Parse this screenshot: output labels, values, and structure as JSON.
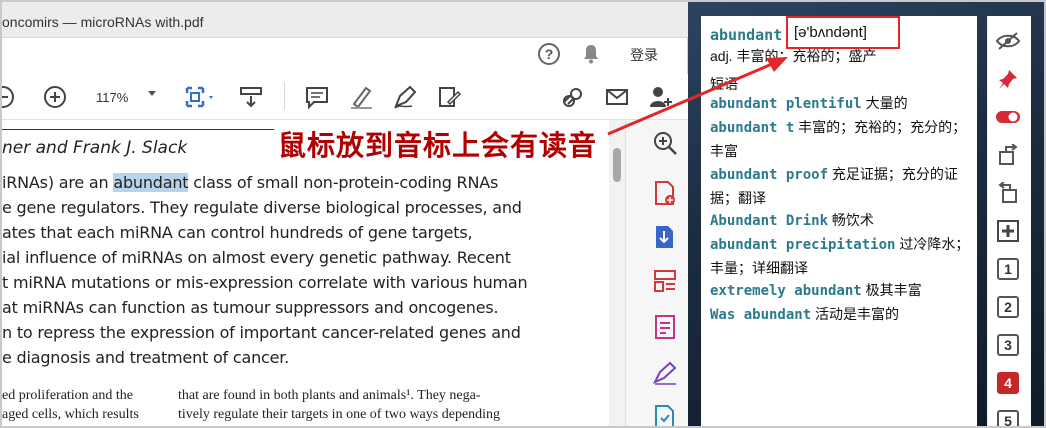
{
  "window": {
    "title": "oncomirs — microRNAs with.pdf"
  },
  "header": {
    "help_glyph": "?",
    "login_label": "登录"
  },
  "toolbar": {
    "zoom_value": "117%"
  },
  "document": {
    "authors": "ner and Frank J. Slack",
    "lines": [
      {
        "pre": "iRNAs) are an ",
        "hl": "abundant",
        "post": " class of small non-protein-coding RNAs"
      },
      {
        "pre": "e gene regulators. They regulate diverse biological processes, and",
        "hl": "",
        "post": ""
      },
      {
        "pre": "ates that each miRNA can control hundreds of gene targets,",
        "hl": "",
        "post": ""
      },
      {
        "pre": "ial influence of miRNAs on almost every genetic pathway. Recent",
        "hl": "",
        "post": ""
      },
      {
        "pre": "t miRNA mutations or mis-expression correlate with various human",
        "hl": "",
        "post": ""
      },
      {
        "pre": "at miRNAs can function as tumour suppressors and oncogenes.",
        "hl": "",
        "post": ""
      },
      {
        "pre": "n to repress the expression of important cancer-related genes and",
        "hl": "",
        "post": ""
      },
      {
        "pre": "e diagnosis and treatment of cancer.",
        "hl": "",
        "post": ""
      }
    ],
    "col_left": [
      "ed proliferation and the",
      "aged cells, which results"
    ],
    "col_right": [
      "that are found in both plants and animals¹. They nega-",
      "tively regulate their targets in one of two ways depending"
    ]
  },
  "annotation": {
    "text": "鼠标放到音标上会有读音",
    "color": "#b00000"
  },
  "dictionary": {
    "headword": "abundant",
    "phonetic": "[ə'bʌndənt]",
    "pos_line": "adj. 丰富的；充裕的；盛产",
    "partial_line": "短语",
    "entries": [
      {
        "key": "abundant plentiful",
        "def": " 大量的"
      },
      {
        "key": "abundant t",
        "def": " 丰富的；充裕的；充分的；丰富"
      },
      {
        "key": "abundant proof",
        "def": " 充足证据；充分的证据；翻译"
      },
      {
        "key": "Abundant Drink",
        "def": " 畅饮术"
      },
      {
        "key": "abundant precipitation",
        "def": " 过冷降水；丰量；详细翻译"
      },
      {
        "key": "extremely abundant",
        "def": " 极其丰富"
      },
      {
        "key": "Was abundant",
        "def": " 活动是丰富的"
      }
    ]
  },
  "side_panel": {
    "numbers": [
      "1",
      "2",
      "3",
      "4",
      "5"
    ],
    "active": "4"
  },
  "colors": {
    "keyword": "#2a7a8c",
    "annotation": "#b00000",
    "phonetic_box": "#e0282a",
    "active_page": "#c62828"
  }
}
